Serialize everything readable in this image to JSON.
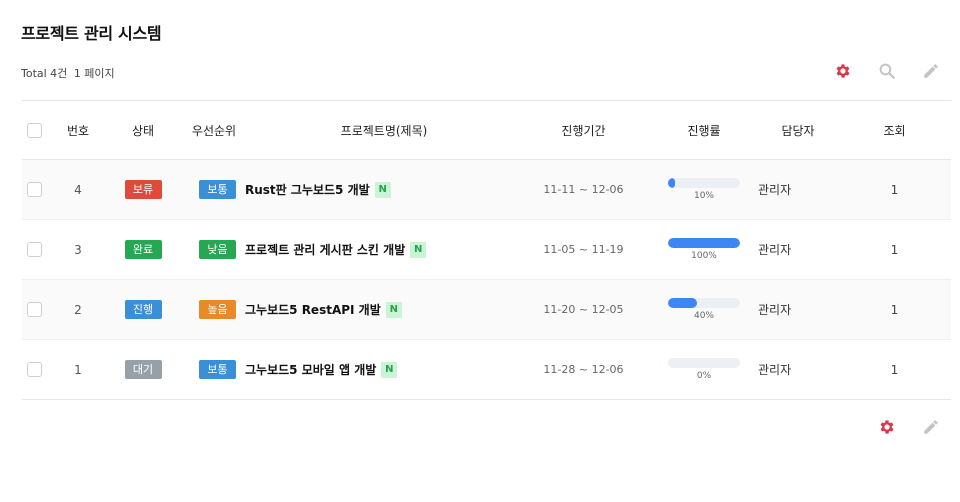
{
  "page": {
    "title": "프로젝트 관리 시스템",
    "total_label": "Total 4건",
    "page_label": "1 페이지"
  },
  "toolbar": {
    "settings_icon": "gear-icon",
    "search_icon": "search-icon",
    "write_icon": "pencil-icon"
  },
  "table": {
    "headers": {
      "num": "번호",
      "status": "상태",
      "priority": "우선순위",
      "title": "프로젝트명(제목)",
      "period": "진행기간",
      "progress": "진행률",
      "manager": "담당자",
      "views": "조회"
    },
    "rows": [
      {
        "num": "4",
        "status": "보류",
        "status_color": "#e04a3c",
        "priority": "보통",
        "priority_color": "#3a8fd7",
        "title": "Rust판 그누보드5 개발",
        "new_badge": "N",
        "period": "11-11 ~ 12-06",
        "progress": 10,
        "progress_label": "10%",
        "manager": "관리자",
        "views": "1"
      },
      {
        "num": "3",
        "status": "완료",
        "status_color": "#27a653",
        "priority": "낮음",
        "priority_color": "#27a653",
        "title": "프로젝트 관리 게시판 스킨 개발",
        "new_badge": "N",
        "period": "11-05 ~ 11-19",
        "progress": 100,
        "progress_label": "100%",
        "manager": "관리자",
        "views": "1"
      },
      {
        "num": "2",
        "status": "진행",
        "status_color": "#3a8fd7",
        "priority": "높음",
        "priority_color": "#e8892a",
        "title": "그누보드5 RestAPI 개발",
        "new_badge": "N",
        "period": "11-20 ~ 12-05",
        "progress": 40,
        "progress_label": "40%",
        "manager": "관리자",
        "views": "1"
      },
      {
        "num": "1",
        "status": "대기",
        "status_color": "#95a0a8",
        "priority": "보통",
        "priority_color": "#3a8fd7",
        "title": "그누보드5 모바일 앱 개발",
        "new_badge": "N",
        "period": "11-28 ~ 12-06",
        "progress": 0,
        "progress_label": "0%",
        "manager": "관리자",
        "views": "1"
      }
    ]
  },
  "colors": {
    "gear": "#d9394a",
    "muted_icon": "#c4c4c4",
    "progress_fill": "#3d86f4",
    "progress_track": "#eceff3"
  }
}
